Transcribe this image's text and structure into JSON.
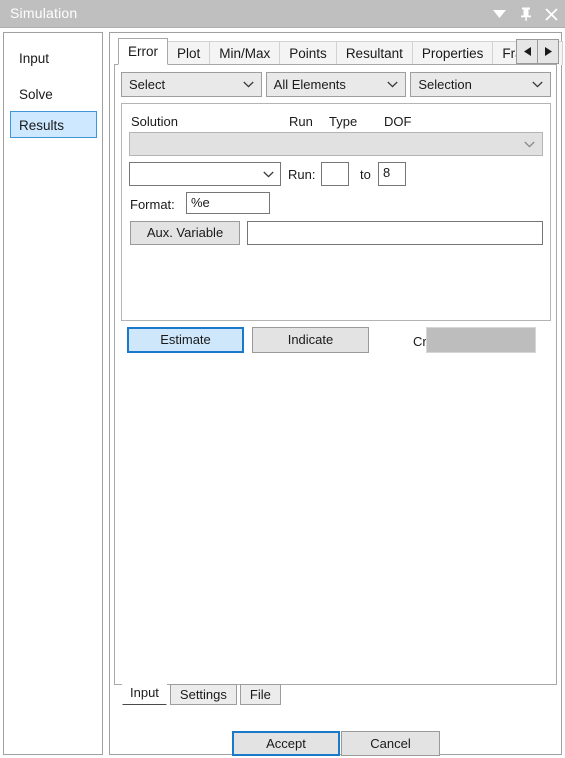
{
  "titlebar": {
    "title": "Simulation",
    "icons": [
      {
        "name": "window-menu-dropdown-icon",
        "glyph": "caret-down"
      },
      {
        "name": "auto-hide-pin-icon",
        "glyph": "pin"
      },
      {
        "name": "close-icon",
        "glyph": "close"
      }
    ]
  },
  "sidebar": {
    "items": [
      {
        "label": "Input",
        "selected": false
      },
      {
        "label": "Solve",
        "selected": false
      },
      {
        "label": "Results",
        "selected": true
      }
    ]
  },
  "tabs": {
    "items": [
      {
        "label": "Error",
        "active": true
      },
      {
        "label": "Plot",
        "active": false
      },
      {
        "label": "Min/Max",
        "active": false
      },
      {
        "label": "Points",
        "active": false
      },
      {
        "label": "Resultant",
        "active": false
      },
      {
        "label": "Properties",
        "active": false
      },
      {
        "label": "Fracture",
        "active": false
      }
    ],
    "scroll_left": "left-arrow-icon",
    "scroll_right": "right-arrow-icon"
  },
  "selectors": [
    {
      "name": "select-mode-combo",
      "value": "Select"
    },
    {
      "name": "element-scope-combo",
      "value": "All Elements"
    },
    {
      "name": "selection-combo",
      "value": "Selection"
    }
  ],
  "solution_group": {
    "headers": {
      "solution": "Solution",
      "run": "Run",
      "type": "Type",
      "dof": "DOF"
    },
    "solution_combo_value": "",
    "run_combo_value": "",
    "run_label": "Run:",
    "run_from_value": "",
    "to_label": "to",
    "run_to_value": "8",
    "format_label": "Format:",
    "format_value": "%e",
    "aux_variable_button": "Aux. Variable",
    "aux_variable_value": ""
  },
  "actions": {
    "estimate_label": "Estimate",
    "indicate_label": "Indicate",
    "criteria_label": "Criteria:",
    "criteria_value": ""
  },
  "bottom_tabs": {
    "items": [
      {
        "label": "Input",
        "active": true
      },
      {
        "label": "Settings",
        "active": false
      },
      {
        "label": "File",
        "active": false
      }
    ]
  },
  "footer": {
    "accept_label": "Accept",
    "cancel_label": "Cancel"
  },
  "colors": {
    "titlebar_bg": "#bfbfbf",
    "accent_blue": "#1a79c8",
    "selection_fill": "#cde8ff",
    "button_face": "#e3e3e3",
    "disabled_field": "#bdbdbd"
  }
}
